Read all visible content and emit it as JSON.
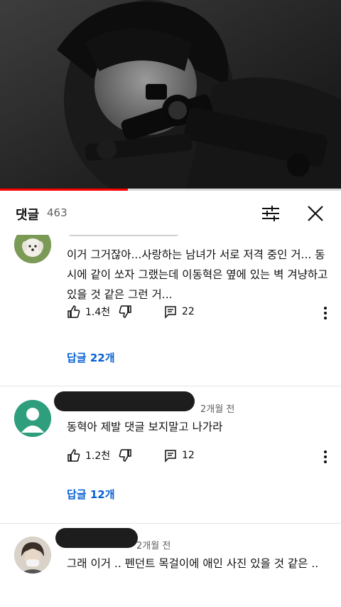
{
  "player": {
    "progress_fraction": 0.375
  },
  "panel": {
    "title": "댓글",
    "count": "463"
  },
  "comments": [
    {
      "text": "이거 그거잖아...사랑하는 남녀가 서로 저격 중인 거... 동시에 같이 쏘자 그랬는데 이동혁은 옆에 있는 벽 겨냥하고 있을 것 같은 그런 거...",
      "likes": "1.4천",
      "replies_count": "22",
      "reply_link": "답글 22개"
    },
    {
      "time": "2개월 전",
      "text": "동혁아 제발 댓글 보지말고 나가라",
      "likes": "1.2천",
      "replies_count": "12",
      "reply_link": "답글 12개"
    },
    {
      "time": "2개월 전",
      "text": "그래 이거 .. 펜던트 목걸이에 애인 사진 있을 것 같은 .."
    }
  ],
  "icons": {
    "like": "thumbs-up-icon",
    "dislike": "thumbs-down-icon",
    "reply": "comment-icon",
    "more": "more-vert-icon",
    "sort": "sort-icon",
    "close": "close-icon"
  },
  "colors": {
    "accent_link": "#065fd4",
    "progress": "#ff0000"
  }
}
